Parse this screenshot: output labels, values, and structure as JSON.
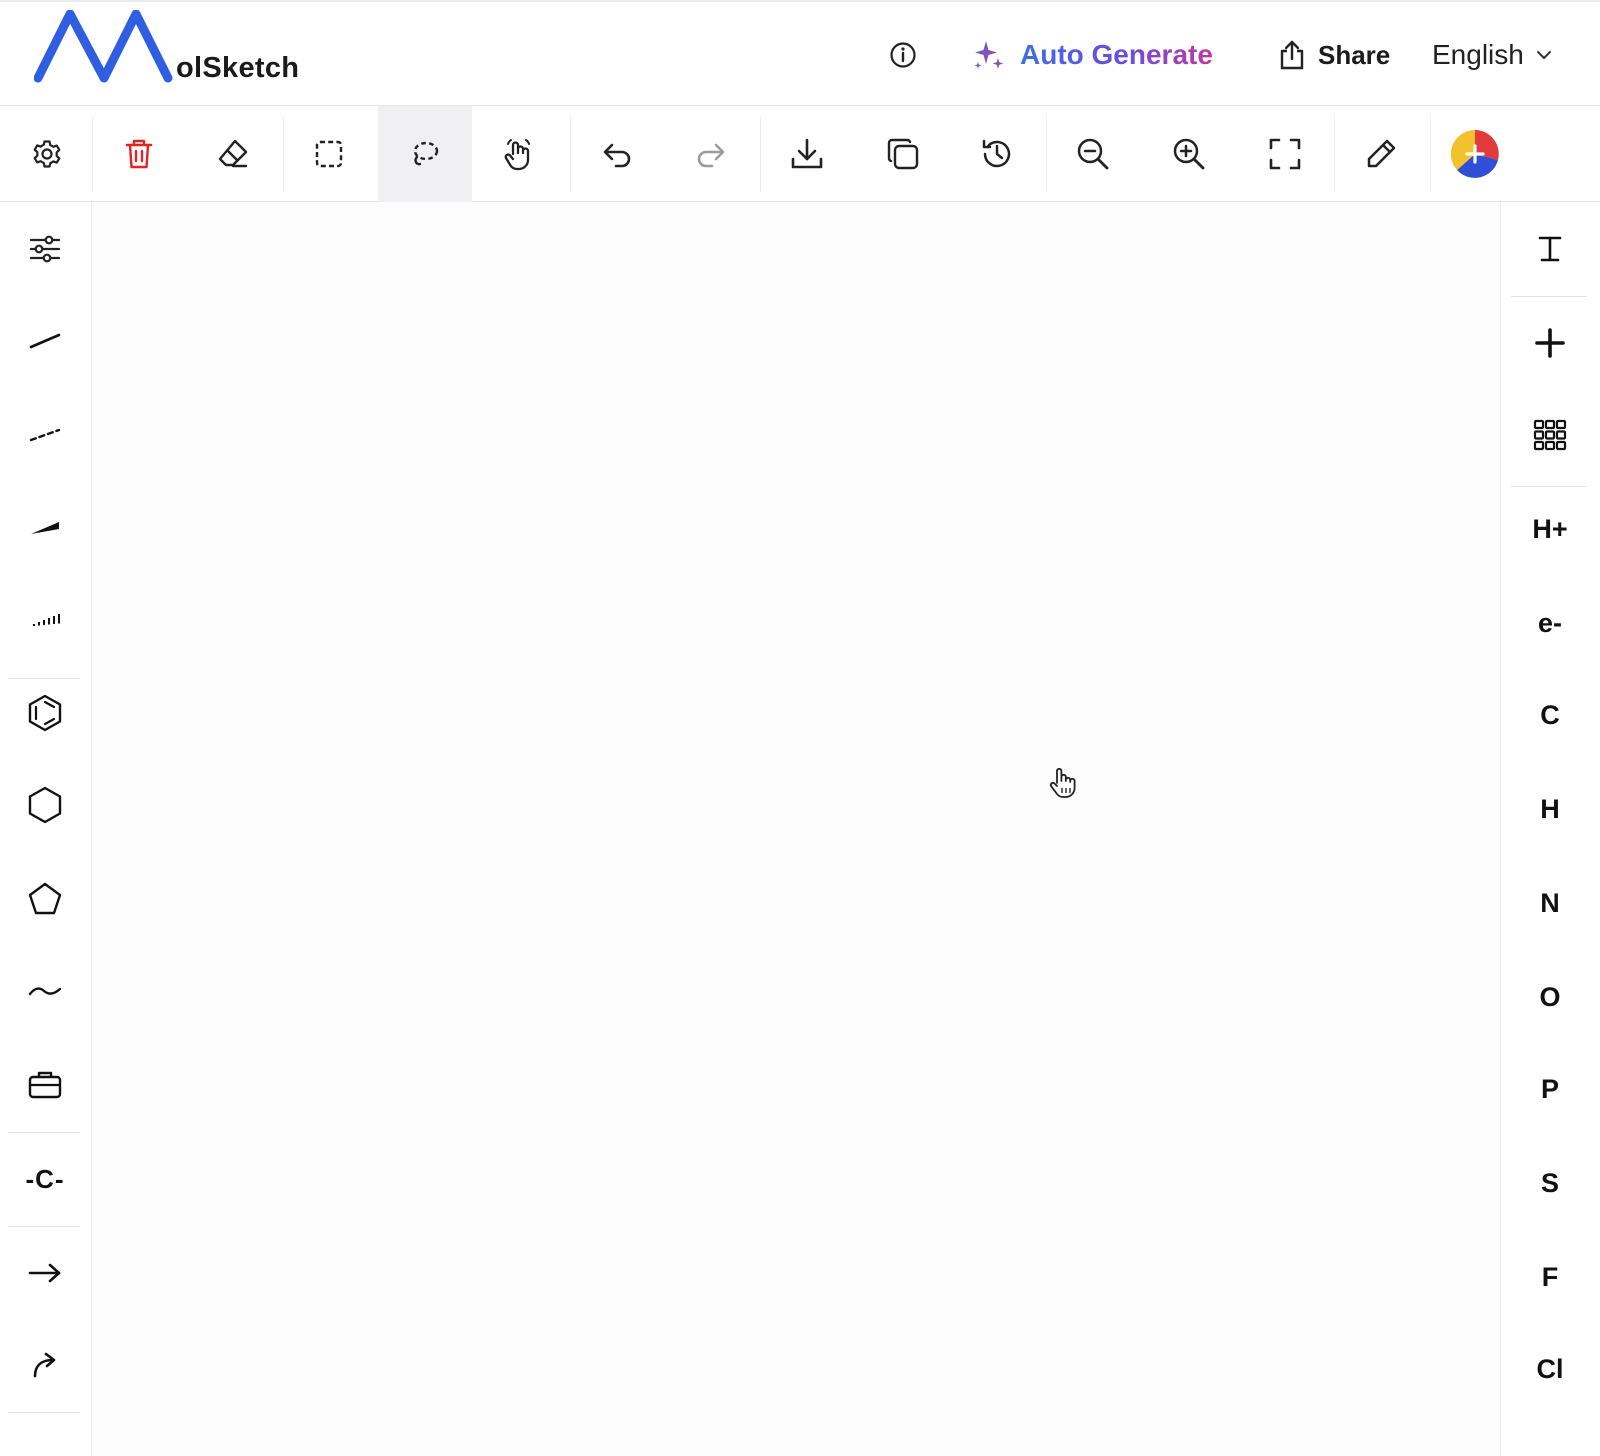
{
  "app": {
    "logo_letter": "M",
    "logo_text": "olSketch"
  },
  "header": {
    "auto_generate_label": "Auto Generate",
    "share_label": "Share",
    "language_label": "English"
  },
  "colors": {
    "brand_blue": "#2f5fe0",
    "delete_red": "#e02424",
    "auto_gen_gradient": [
      "#3b6fe4",
      "#6a4be0",
      "#c23a9a"
    ]
  },
  "toolbar": {
    "items": [
      {
        "name": "settings",
        "icon": "gear-icon"
      },
      {
        "name": "delete",
        "icon": "trash-icon"
      },
      {
        "name": "eraser",
        "icon": "eraser-icon"
      },
      {
        "name": "rect-select",
        "icon": "rect-select-icon"
      },
      {
        "name": "lasso-select",
        "icon": "lasso-icon",
        "active": true
      },
      {
        "name": "pan",
        "icon": "hand-icon"
      },
      {
        "name": "undo",
        "icon": "undo-icon"
      },
      {
        "name": "redo",
        "icon": "redo-icon"
      },
      {
        "name": "download",
        "icon": "download-icon"
      },
      {
        "name": "copy",
        "icon": "copy-icon"
      },
      {
        "name": "history",
        "icon": "history-icon"
      },
      {
        "name": "zoom-out",
        "icon": "zoom-out-icon"
      },
      {
        "name": "zoom-in",
        "icon": "zoom-in-icon"
      },
      {
        "name": "fullscreen",
        "icon": "fullscreen-icon"
      },
      {
        "name": "pen",
        "icon": "pencil-icon"
      },
      {
        "name": "color-add",
        "icon": "color-wheel-icon"
      }
    ]
  },
  "left_tools": [
    {
      "name": "adjust",
      "icon": "sliders-icon"
    },
    {
      "name": "single-bond",
      "icon": "single-bond-icon"
    },
    {
      "name": "dashed-bond",
      "icon": "dashed-bond-icon"
    },
    {
      "name": "wedge-bond",
      "icon": "wedge-bond-icon"
    },
    {
      "name": "hash-bond",
      "icon": "hash-bond-icon"
    },
    {
      "name": "benzene",
      "icon": "benzene-icon"
    },
    {
      "name": "cyclohexane",
      "icon": "hexagon-icon"
    },
    {
      "name": "cyclopentane",
      "icon": "pentagon-icon"
    },
    {
      "name": "chain",
      "icon": "chain-icon"
    },
    {
      "name": "templates",
      "icon": "briefcase-icon"
    },
    {
      "name": "carbon-chain",
      "label": "-C-"
    },
    {
      "name": "arrow",
      "icon": "arrow-right-icon"
    },
    {
      "name": "curved-arrow",
      "icon": "curved-arrow-icon"
    }
  ],
  "right_tools": {
    "text_tool_icon": "text-cursor-icon",
    "add_icon": "plus-icon",
    "periodic_icon": "grid-icon",
    "elements": [
      "H+",
      "e-",
      "C",
      "H",
      "N",
      "O",
      "P",
      "S",
      "F",
      "Cl"
    ]
  }
}
